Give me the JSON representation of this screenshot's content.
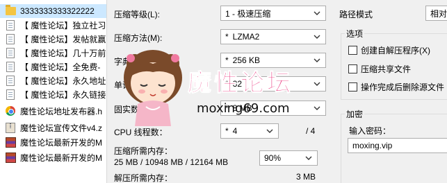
{
  "file_list": [
    {
      "name": "3333333333322222",
      "icon": "folder-icon",
      "selected": true
    },
    {
      "name": "【 魔性论坛】独立社习",
      "icon": "document-icon"
    },
    {
      "name": "【 魔性论坛】发帖就赢",
      "icon": "document-icon"
    },
    {
      "name": "【 魔性论坛】几十万前",
      "icon": "document-icon"
    },
    {
      "name": "【 魔性论坛】全免费-",
      "icon": "document-icon"
    },
    {
      "name": "【 魔性论坛】永久地址",
      "icon": "document-icon"
    },
    {
      "name": "【 魔性论坛】永久链接",
      "icon": "document-icon"
    },
    {
      "name": "魔性论坛地址发布器.h",
      "icon": "chrome-icon"
    },
    {
      "name": "魔性论坛宣传文件v4.z",
      "icon": "zip-icon"
    },
    {
      "name": "魔性论坛最新开发的M",
      "icon": "rar-icon"
    },
    {
      "name": "魔性论坛最新开发的M",
      "icon": "rar-icon"
    }
  ],
  "dialog": {
    "compression_level": {
      "label": "压缩等级(L):",
      "value": "1 - 极速压缩"
    },
    "compression_method": {
      "label": "压缩方法(M):",
      "value": "LZMA2",
      "prefix": "*"
    },
    "dictionary_size": {
      "label": "字典大小(D):",
      "value": "256 KB",
      "prefix": "*"
    },
    "word_size": {
      "label": "单词大小(W):",
      "value": "32",
      "prefix": "*"
    },
    "solid_block": {
      "label": "固实数据大小:",
      "value": "8 MB",
      "prefix": "*"
    },
    "cpu_threads": {
      "label": "CPU 线程数：",
      "value": "4",
      "prefix": "*",
      "total": "/ 4"
    },
    "memory_compress": {
      "label": "压缩所需内存：",
      "detail": "25 MB / 10948 MB / 12164 MB",
      "percent": "90%"
    },
    "memory_decompress": {
      "label": "解压所需内存：",
      "value": "3 MB"
    },
    "path_mode": {
      "label": "路径模式",
      "value": "相对"
    },
    "options": {
      "title": "选项",
      "items": [
        "创建自解压程序(X)",
        "压缩共享文件",
        "操作完成后删除源文件"
      ]
    },
    "encryption": {
      "title": "加密",
      "password_label": "输入密码：",
      "password_value": "moxing.vip"
    }
  },
  "watermark": {
    "text": "魔性论坛",
    "url": "moxing69.com"
  }
}
